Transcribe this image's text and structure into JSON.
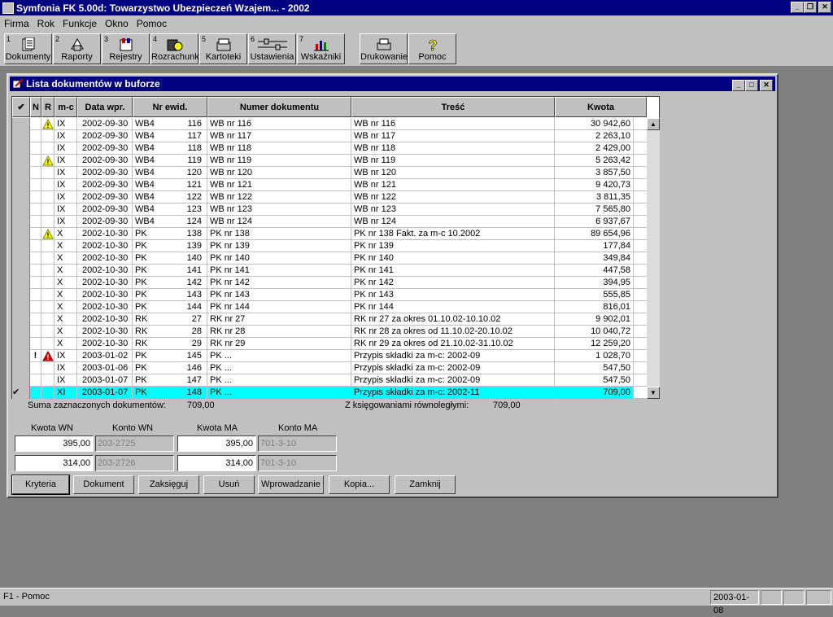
{
  "app": {
    "title": "Symfonia FK  5.00d: Towarzystwo Ubezpieczeń Wzajem... - 2002",
    "window_buttons": [
      "_",
      "❐",
      "✕"
    ]
  },
  "menu": [
    "Firma",
    "Rok",
    "Funkcje",
    "Okno",
    "Pomoc"
  ],
  "toolbar": [
    {
      "num": "1",
      "label": "Dokumenty",
      "icon": "documents-icon"
    },
    {
      "num": "2",
      "label": "Raporty",
      "icon": "reports-icon"
    },
    {
      "num": "3",
      "label": "Rejestry",
      "icon": "registers-icon"
    },
    {
      "num": "4",
      "label": "Rozrachunki",
      "icon": "settlements-icon"
    },
    {
      "num": "5",
      "label": "Kartoteki",
      "icon": "files-icon"
    },
    {
      "num": "6",
      "label": "Ustawienia",
      "icon": "settings-icon"
    },
    {
      "num": "7",
      "label": "Wskaźniki",
      "icon": "indicators-icon"
    },
    {
      "num": "",
      "label": "Drukowanie",
      "icon": "printer-icon"
    },
    {
      "num": "",
      "label": "Pomoc",
      "icon": "help-icon"
    }
  ],
  "docwin": {
    "title": "Lista dokumentów w buforze",
    "columns": [
      "✔",
      "N",
      "R",
      "m-c",
      "Data wpr.",
      "Nr ewid.",
      "Numer dokumentu",
      "Treść",
      "Kwota"
    ],
    "rows": [
      {
        "check": "",
        "n": "",
        "r": "warn",
        "mc": "IX",
        "date": "2002-09-30",
        "type": "WB4",
        "nr": "116",
        "doc": "WB nr 116",
        "desc": "WB nr  116",
        "amount": "30 942,60"
      },
      {
        "check": "",
        "n": "",
        "r": "",
        "mc": "IX",
        "date": "2002-09-30",
        "type": "WB4",
        "nr": "117",
        "doc": "WB nr 117",
        "desc": "WB nr  117",
        "amount": "2 263,10"
      },
      {
        "check": "",
        "n": "",
        "r": "",
        "mc": "IX",
        "date": "2002-09-30",
        "type": "WB4",
        "nr": "118",
        "doc": "WB nr 118",
        "desc": "WB nr  118",
        "amount": "2 429,00"
      },
      {
        "check": "",
        "n": "",
        "r": "warn",
        "mc": "IX",
        "date": "2002-09-30",
        "type": "WB4",
        "nr": "119",
        "doc": "WB nr 119",
        "desc": "WB nr  119",
        "amount": "5 263,42"
      },
      {
        "check": "",
        "n": "",
        "r": "",
        "mc": "IX",
        "date": "2002-09-30",
        "type": "WB4",
        "nr": "120",
        "doc": "WB nr 120",
        "desc": "WB nr  120",
        "amount": "3 857,50"
      },
      {
        "check": "",
        "n": "",
        "r": "",
        "mc": "IX",
        "date": "2002-09-30",
        "type": "WB4",
        "nr": "121",
        "doc": "WB nr 121",
        "desc": "WB nr  121",
        "amount": "9 420,73"
      },
      {
        "check": "",
        "n": "",
        "r": "",
        "mc": "IX",
        "date": "2002-09-30",
        "type": "WB4",
        "nr": "122",
        "doc": "WB nr 122",
        "desc": "WB nr  122",
        "amount": "3 811,35"
      },
      {
        "check": "",
        "n": "",
        "r": "",
        "mc": "IX",
        "date": "2002-09-30",
        "type": "WB4",
        "nr": "123",
        "doc": "WB nr 123",
        "desc": "WB nr  123",
        "amount": "7 565,80"
      },
      {
        "check": "",
        "n": "",
        "r": "",
        "mc": "IX",
        "date": "2002-09-30",
        "type": "WB4",
        "nr": "124",
        "doc": "WB nr 124",
        "desc": "WB nr  124",
        "amount": "6 937,67"
      },
      {
        "check": "",
        "n": "",
        "r": "warn",
        "mc": "X",
        "date": "2002-10-30",
        "type": "PK",
        "nr": "138",
        "doc": "PK nr 138",
        "desc": "PK nr  138 Fakt. za m-c  10.2002",
        "amount": "89 654,96"
      },
      {
        "check": "",
        "n": "",
        "r": "",
        "mc": "X",
        "date": "2002-10-30",
        "type": "PK",
        "nr": "139",
        "doc": "PK nr 139",
        "desc": "PK nr  139",
        "amount": "177,84"
      },
      {
        "check": "",
        "n": "",
        "r": "",
        "mc": "X",
        "date": "2002-10-30",
        "type": "PK",
        "nr": "140",
        "doc": "PK nr 140",
        "desc": "PK nr  140",
        "amount": "349,84"
      },
      {
        "check": "",
        "n": "",
        "r": "",
        "mc": "X",
        "date": "2002-10-30",
        "type": "PK",
        "nr": "141",
        "doc": "PK nr 141",
        "desc": "PK nr  141",
        "amount": "447,58"
      },
      {
        "check": "",
        "n": "",
        "r": "",
        "mc": "X",
        "date": "2002-10-30",
        "type": "PK",
        "nr": "142",
        "doc": "PK nr 142",
        "desc": "PK nr  142",
        "amount": "394,95"
      },
      {
        "check": "",
        "n": "",
        "r": "",
        "mc": "X",
        "date": "2002-10-30",
        "type": "PK",
        "nr": "143",
        "doc": "PK nr 143",
        "desc": "PK nr  143",
        "amount": "555,85"
      },
      {
        "check": "",
        "n": "",
        "r": "",
        "mc": "X",
        "date": "2002-10-30",
        "type": "PK",
        "nr": "144",
        "doc": "PK nr 144",
        "desc": "PK nr  144",
        "amount": "816,01"
      },
      {
        "check": "",
        "n": "",
        "r": "",
        "mc": "X",
        "date": "2002-10-30",
        "type": "RK",
        "nr": "27",
        "doc": "RK nr 27",
        "desc": "RK nr  27 za okres 01.10.02-10.10.02",
        "amount": "9 902,01"
      },
      {
        "check": "",
        "n": "",
        "r": "",
        "mc": "X",
        "date": "2002-10-30",
        "type": "RK",
        "nr": "28",
        "doc": "RK nr 28",
        "desc": "RK nr  28  za okres od 11.10.02-20.10.02",
        "amount": "10 040,72"
      },
      {
        "check": "",
        "n": "",
        "r": "",
        "mc": "X",
        "date": "2002-10-30",
        "type": "RK",
        "nr": "29",
        "doc": "RK nr 29",
        "desc": "RK nr  29 za okres od 21.10.02-31.10.02",
        "amount": "12 259,20"
      },
      {
        "check": "",
        "n": "!",
        "r": "error",
        "mc": "IX",
        "date": "2003-01-02",
        "type": "PK",
        "nr": "145",
        "doc": "PK ...",
        "desc": "Przypis składki za m-c: 2002-09",
        "amount": "1 028,70"
      },
      {
        "check": "",
        "n": "",
        "r": "",
        "mc": "IX",
        "date": "2003-01-06",
        "type": "PK",
        "nr": "146",
        "doc": "PK ...",
        "desc": "Przypis składki za m-c: 2002-09",
        "amount": "547,50"
      },
      {
        "check": "",
        "n": "",
        "r": "",
        "mc": "IX",
        "date": "2003-01-07",
        "type": "PK",
        "nr": "147",
        "doc": "PK ...",
        "desc": "Przypis składki za m-c: 2002-09",
        "amount": "547,50"
      },
      {
        "check": "✔",
        "n": "",
        "r": "",
        "mc": "XI",
        "date": "2003-01-07",
        "type": "PK",
        "nr": "148",
        "doc": "PK ...",
        "desc": "Przypis składki za m-c: 2002-11",
        "amount": "709,00",
        "selected": true
      }
    ],
    "sum_label": "Suma zaznaczonych dokumentów:",
    "sum_value": "709,00",
    "parallel_label": "Z księgowaniami równoległymi:",
    "parallel_value": "709,00",
    "kwota_wn_label": "Kwota WN",
    "konto_wn_label": "Konto WN",
    "kwota_ma_label": "Kwota MA",
    "konto_ma_label": "Konto MA",
    "entries": [
      {
        "wn": "395,00",
        "konto_wn": "203-2725",
        "ma": "395,00",
        "konto_ma": "701-3-10"
      },
      {
        "wn": "314,00",
        "konto_wn": "203-2726",
        "ma": "314,00",
        "konto_ma": "701-3-10"
      }
    ],
    "buttons": [
      "Kryteria",
      "Dokument",
      "Zaksięguj",
      "Usuń",
      "Wprowadzanie",
      "Kopia...",
      "Zamknij"
    ]
  },
  "status": {
    "help": "F1 - Pomoc",
    "date": "2003-01-08"
  },
  "colors": {
    "titlebar": "#000080",
    "selection": "#00ffff",
    "face": "#c0c0c0"
  }
}
